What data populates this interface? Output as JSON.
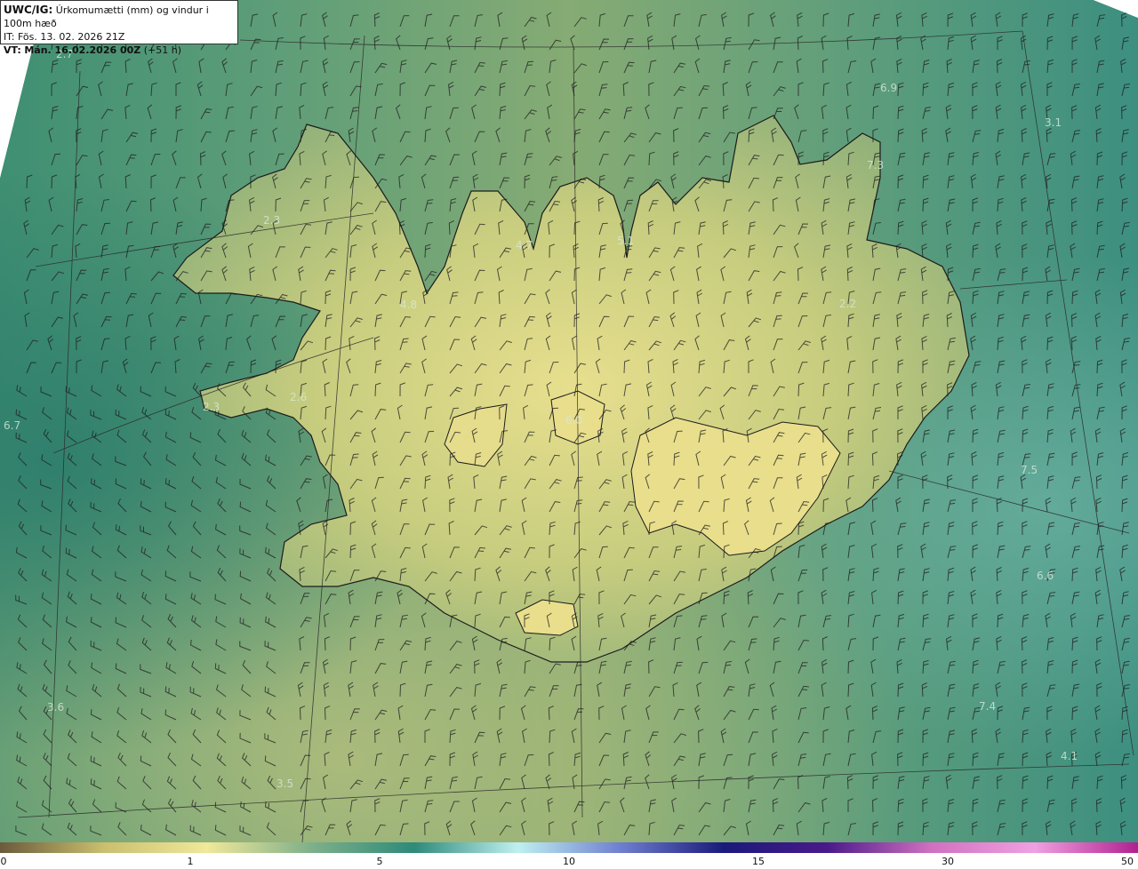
{
  "header": {
    "model": "UWC/IG:",
    "title": "Úrkomumætti (mm) og vindur i 100m hæð",
    "issue_time": "IT: Fös. 13. 02. 2026 21Z",
    "valid_label": "VT:",
    "valid_time": "Mán. 16.02.2026 00Z",
    "valid_offset": "(+51 h)"
  },
  "map_values": [
    {
      "text": "2.7"
    },
    {
      "text": "6.9"
    },
    {
      "text": "3.1"
    },
    {
      "text": "7.3"
    },
    {
      "text": "2.3"
    },
    {
      "text": "4.7"
    },
    {
      "text": "5.1"
    },
    {
      "text": "4.8"
    },
    {
      "text": "2.2"
    },
    {
      "text": "2.3"
    },
    {
      "text": "2.6"
    },
    {
      "text": "6.7"
    },
    {
      "text": "6.0"
    },
    {
      "text": "7.5"
    },
    {
      "text": "6.6"
    },
    {
      "text": "3.6"
    },
    {
      "text": "7.4"
    },
    {
      "text": "4.1"
    },
    {
      "text": "3.5"
    }
  ],
  "colorbar": {
    "ticks": [
      {
        "label": "0",
        "value": 0
      },
      {
        "label": "1",
        "value": 1
      },
      {
        "label": "5",
        "value": 5
      },
      {
        "label": "10",
        "value": 10
      },
      {
        "label": "15",
        "value": 15
      },
      {
        "label": "30",
        "value": 30
      },
      {
        "label": "50",
        "value": 50
      }
    ],
    "colors": [
      "#6b5a3c",
      "#c9bf6e",
      "#f0e89a",
      "#7fb08a",
      "#2e8a7a",
      "#bff0f0",
      "#6f7fd0",
      "#1a1a7a",
      "#4a1a8a",
      "#d070c0",
      "#f0a0e0",
      "#b02090"
    ]
  }
}
